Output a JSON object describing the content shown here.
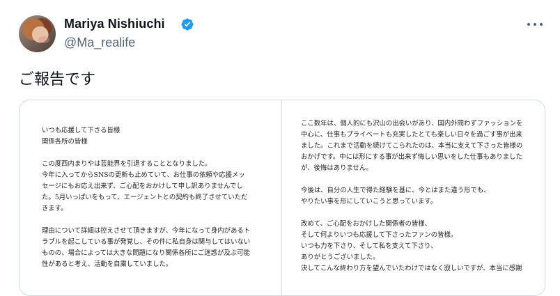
{
  "author": {
    "display_name": "Mariya Nishiuchi",
    "handle": "@Ma_realife",
    "avatar_icon": "profile-photo",
    "verified_icon": "verified-badge-icon",
    "verified_color": "#1d9bf0"
  },
  "menu": {
    "icon": "more-horizontal-icon"
  },
  "tweet": {
    "text": "ご報告です"
  },
  "media": {
    "left_page": {
      "lines": [
        "いつも応援して下さる皆様",
        "関係各所の皆様",
        "",
        "この度西内まりやは芸能界を引退することとなりました。",
        "今年に入ってからSNSの更新も止めていて、お仕事の依頼や応援メッ",
        "セージにもお応え出来ず、ご心配をおかけして申し訳ありませんでし",
        "た。5月いっぱいをもって、エージェントとの契約も終了させていただ",
        "きます。",
        "",
        "理由について詳細は控えさせて頂きますが、今年になって身内があるト",
        "ラブルを起こしている事が発覚し、その件に私自身は関与してはいない",
        "ものの、場合によっては大きな問題になり関係各所にご迷惑が及ぶ可能",
        "性があると考え、活動を自粛していました。"
      ]
    },
    "right_page": {
      "lines": [
        "ここ数年は、個人的にも沢山の出会いがあり、国内外問わずファッションを",
        "中心に、仕事もプライベートも充実したとても楽しい日々を過ごす事が出来",
        "ました。これまで活動を続けてこられたのは、本当に支えて下さった皆様の",
        "おかげです。中には形にする事が出来ず悔しい思いをした仕事もありました",
        "が、後悔はありません。",
        "",
        "今後は、自分の人生で得た経験を基に、今とはまた違う形でも、",
        "やりたい事を形にしていこうと思っています。",
        "",
        "改めて、ご心配をおかけした関係者の皆様、",
        "そして何よりいつも応援して下さったファンの皆様。",
        "いつも力を下さり、そして私を支えて下さり、",
        "ありがとうございました。",
        "決してこんな終わり方を望んでいたわけではなく寂しいですが、本当に感謝"
      ]
    }
  }
}
